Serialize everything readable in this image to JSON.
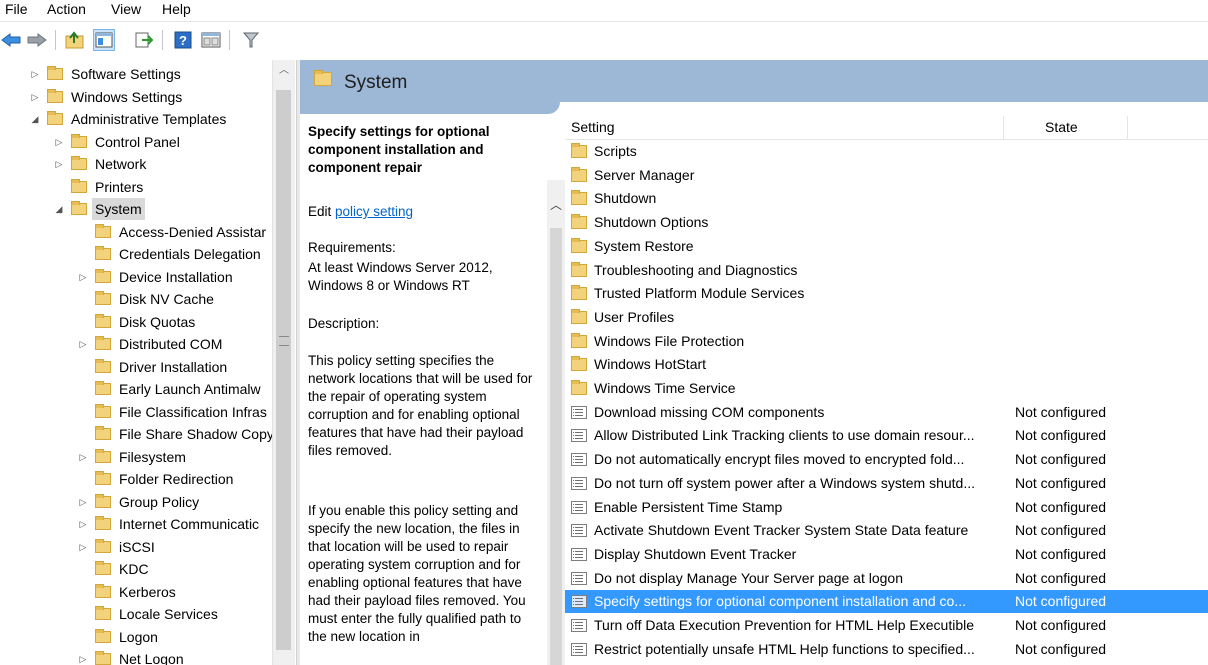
{
  "menu": [
    "File",
    "Action",
    "View",
    "Help"
  ],
  "toolbar": {
    "icons": [
      "back-arrow-icon",
      "forward-arrow-icon",
      "up-folder-icon",
      "show-hide-tree-icon",
      "export-list-icon",
      "help-icon",
      "properties-icon",
      "filter-icon"
    ]
  },
  "tree": {
    "items": [
      {
        "label": "Software Settings",
        "level": 1,
        "exp": "▷"
      },
      {
        "label": "Windows Settings",
        "level": 1,
        "exp": "▷"
      },
      {
        "label": "Administrative Templates",
        "level": 1,
        "exp": "◢"
      },
      {
        "label": "Control Panel",
        "level": 2,
        "exp": "▷"
      },
      {
        "label": "Network",
        "level": 2,
        "exp": "▷"
      },
      {
        "label": "Printers",
        "level": 2,
        "exp": ""
      },
      {
        "label": "System",
        "level": 2,
        "exp": "◢",
        "selected": true
      },
      {
        "label": "Access-Denied Assistar",
        "level": 3,
        "exp": ""
      },
      {
        "label": "Credentials Delegation",
        "level": 3,
        "exp": ""
      },
      {
        "label": "Device Installation",
        "level": 3,
        "exp": "▷"
      },
      {
        "label": "Disk NV Cache",
        "level": 3,
        "exp": ""
      },
      {
        "label": "Disk Quotas",
        "level": 3,
        "exp": ""
      },
      {
        "label": "Distributed COM",
        "level": 3,
        "exp": "▷"
      },
      {
        "label": "Driver Installation",
        "level": 3,
        "exp": ""
      },
      {
        "label": "Early Launch Antimalw",
        "level": 3,
        "exp": ""
      },
      {
        "label": "File Classification Infras",
        "level": 3,
        "exp": ""
      },
      {
        "label": "File Share Shadow Copy",
        "level": 3,
        "exp": ""
      },
      {
        "label": "Filesystem",
        "level": 3,
        "exp": "▷"
      },
      {
        "label": "Folder Redirection",
        "level": 3,
        "exp": ""
      },
      {
        "label": "Group Policy",
        "level": 3,
        "exp": "▷"
      },
      {
        "label": "Internet Communicatic",
        "level": 3,
        "exp": "▷"
      },
      {
        "label": "iSCSI",
        "level": 3,
        "exp": "▷"
      },
      {
        "label": "KDC",
        "level": 3,
        "exp": ""
      },
      {
        "label": "Kerberos",
        "level": 3,
        "exp": ""
      },
      {
        "label": "Locale Services",
        "level": 3,
        "exp": ""
      },
      {
        "label": "Logon",
        "level": 3,
        "exp": ""
      },
      {
        "label": "Net Logon",
        "level": 3,
        "exp": "▷"
      }
    ]
  },
  "header": {
    "title": "System"
  },
  "description": {
    "heading": "Specify settings for optional component installation and component repair",
    "edit_prefix": "Edit ",
    "edit_link": "policy setting",
    "requirements_label": "Requirements:",
    "requirements_text": "At least Windows Server 2012, Windows 8 or Windows RT",
    "description_label": "Description:",
    "para1": "This policy setting specifies the network locations that will be used for the repair of operating system corruption and for enabling optional features that have had their payload files removed.",
    "para2": "If you enable this policy setting and specify the new location, the files in that location will be used to repair operating system corruption and for enabling optional features that have had their payload files removed. You must enter the fully qualified path to the new location in"
  },
  "list": {
    "columns": {
      "setting": "Setting",
      "state": "State"
    },
    "rows": [
      {
        "type": "folder",
        "name": "Scripts",
        "state": ""
      },
      {
        "type": "folder",
        "name": "Server Manager",
        "state": ""
      },
      {
        "type": "folder",
        "name": "Shutdown",
        "state": ""
      },
      {
        "type": "folder",
        "name": "Shutdown Options",
        "state": ""
      },
      {
        "type": "folder",
        "name": "System Restore",
        "state": ""
      },
      {
        "type": "folder",
        "name": "Troubleshooting and Diagnostics",
        "state": ""
      },
      {
        "type": "folder",
        "name": "Trusted Platform Module Services",
        "state": ""
      },
      {
        "type": "folder",
        "name": "User Profiles",
        "state": ""
      },
      {
        "type": "folder",
        "name": "Windows File Protection",
        "state": ""
      },
      {
        "type": "folder",
        "name": "Windows HotStart",
        "state": ""
      },
      {
        "type": "folder",
        "name": "Windows Time Service",
        "state": ""
      },
      {
        "type": "policy",
        "name": "Download missing COM components",
        "state": "Not configured"
      },
      {
        "type": "policy",
        "name": "Allow Distributed Link Tracking clients to use domain resour...",
        "state": "Not configured"
      },
      {
        "type": "policy",
        "name": "Do not automatically encrypt files moved to encrypted fold...",
        "state": "Not configured"
      },
      {
        "type": "policy",
        "name": "Do not turn off system power after a Windows system shutd...",
        "state": "Not configured"
      },
      {
        "type": "policy",
        "name": "Enable Persistent Time Stamp",
        "state": "Not configured"
      },
      {
        "type": "policy",
        "name": "Activate Shutdown Event Tracker System State Data feature",
        "state": "Not configured"
      },
      {
        "type": "policy",
        "name": "Display Shutdown Event Tracker",
        "state": "Not configured"
      },
      {
        "type": "policy",
        "name": "Do not display Manage Your Server page at logon",
        "state": "Not configured"
      },
      {
        "type": "policy",
        "name": "Specify settings for optional component installation and co...",
        "state": "Not configured",
        "selected": true
      },
      {
        "type": "policy",
        "name": "Turn off Data Execution Prevention for HTML Help Executible",
        "state": "Not configured"
      },
      {
        "type": "policy",
        "name": "Restrict potentially unsafe HTML Help functions to specified...",
        "state": "Not configured"
      }
    ]
  },
  "colors": {
    "header_bg": "#9db8d7",
    "selection_bg": "#3399ff",
    "link": "#0066cc",
    "folder": "#f3d27c"
  }
}
